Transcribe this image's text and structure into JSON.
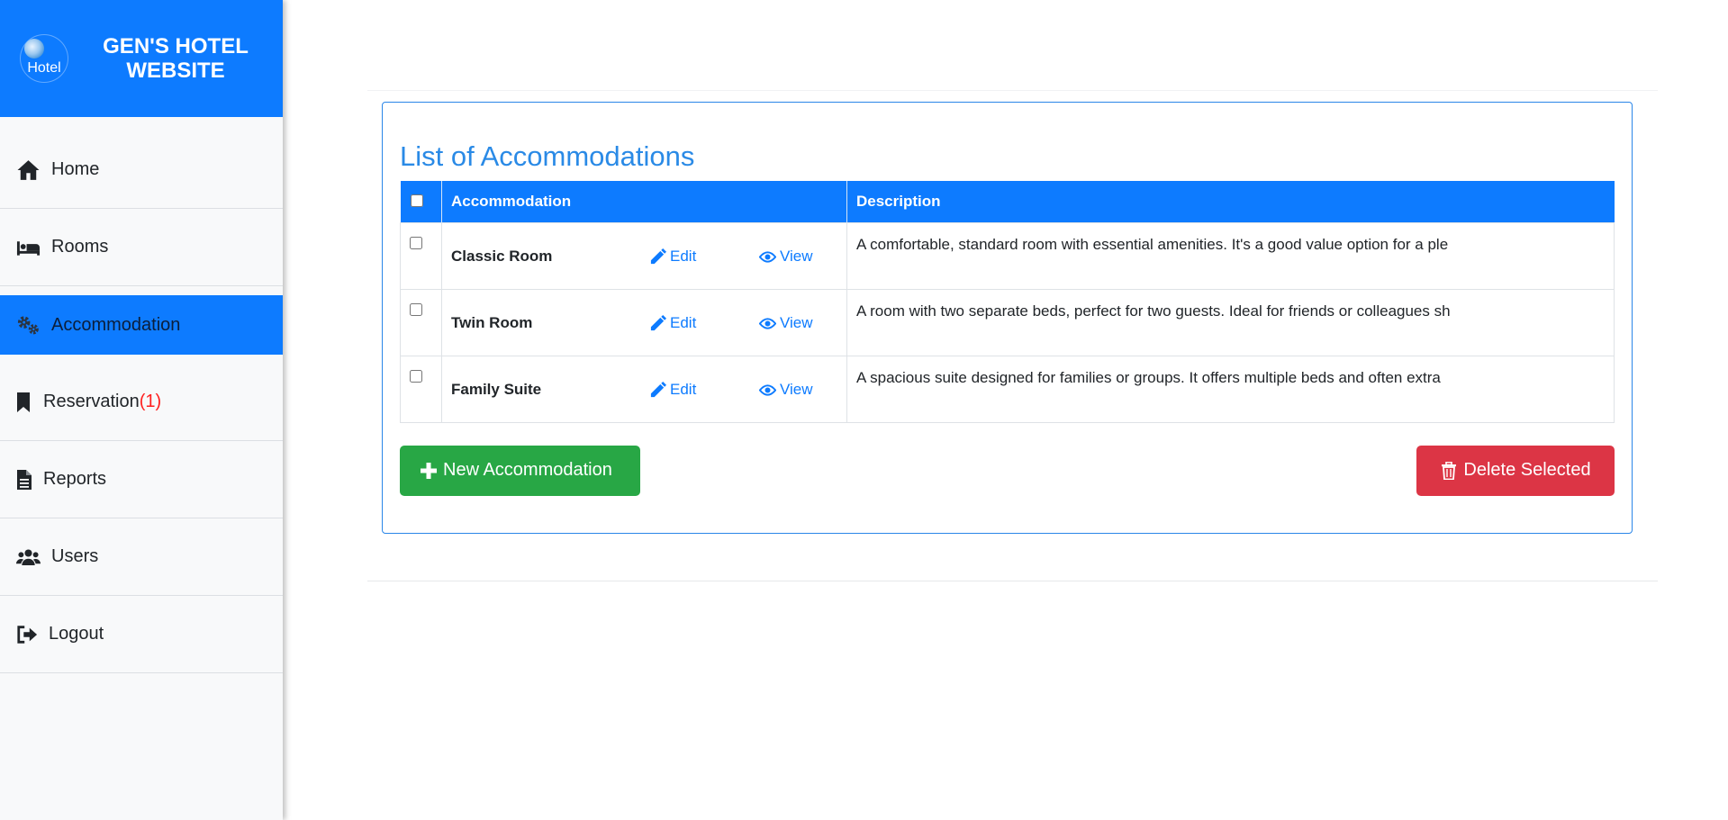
{
  "brand": {
    "logo_text": "Hotel",
    "title": "GEN'S HOTEL WEBSITE"
  },
  "nav": {
    "home": "Home",
    "rooms": "Rooms",
    "accommodation": "Accommodation",
    "reservation": "Reservation",
    "reservation_count": "(1)",
    "reports": "Reports",
    "users": "Users",
    "logout": "Logout"
  },
  "main": {
    "title": "List of Accommodations",
    "table": {
      "headers": [
        "Accommodation",
        "Description"
      ],
      "rows": [
        {
          "name": "Classic Room",
          "edit": "Edit",
          "view": "View",
          "description": "A comfortable, standard room with essential amenities. It's a good value option for a ple"
        },
        {
          "name": "Twin Room",
          "edit": "Edit",
          "view": "View",
          "description": "A room with two separate beds, perfect for two guests. Ideal for friends or colleagues sh"
        },
        {
          "name": "Family Suite",
          "edit": "Edit",
          "view": "View",
          "description": "A spacious suite designed for families or groups. It offers multiple beds and often extra"
        }
      ]
    },
    "new_button": "New Accommodation",
    "delete_button": "Delete Selected"
  },
  "colors": {
    "primary": "#0d7bff",
    "success": "#28a745",
    "danger": "#dc3545",
    "title": "#2a8ae6",
    "badge": "#ff1f1f"
  }
}
